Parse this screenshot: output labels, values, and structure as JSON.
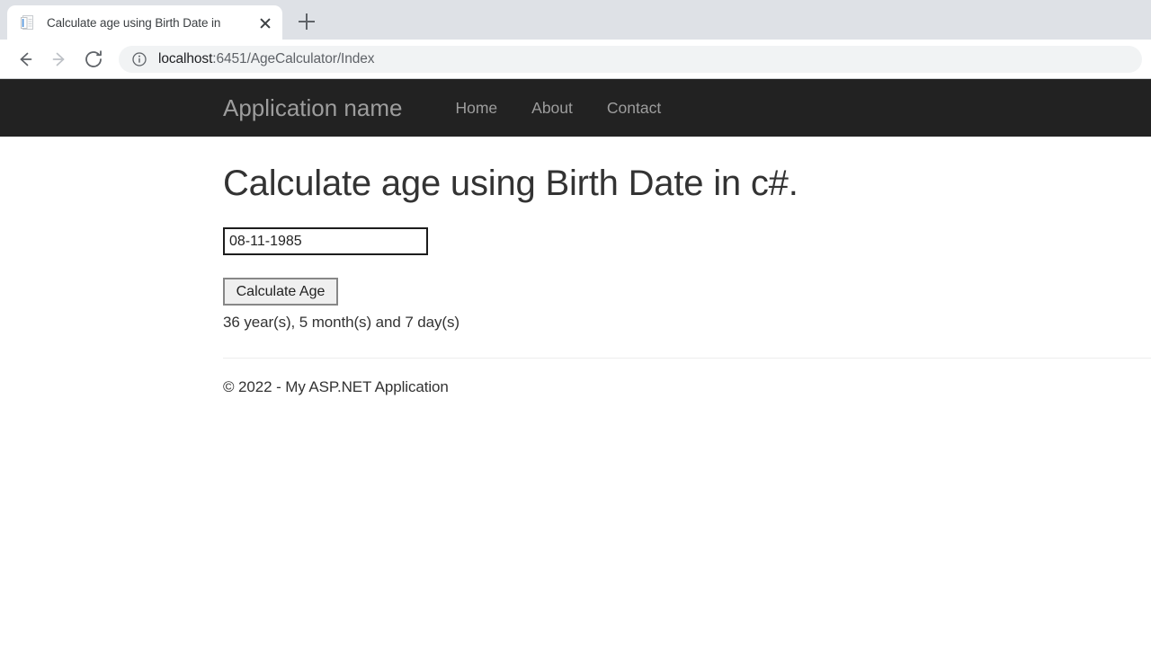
{
  "browser": {
    "tab": {
      "title": "Calculate age using Birth Date in",
      "favicon_name": "document-favicon",
      "close_label": "Close tab"
    },
    "new_tab_label": "New tab",
    "toolbar": {
      "back_label": "Back",
      "forward_label": "Forward",
      "reload_label": "Reload",
      "site_info_label": "View site information",
      "url_host": "localhost",
      "url_path": ":6451/AgeCalculator/Index"
    }
  },
  "page": {
    "navbar": {
      "brand": "Application name",
      "links": [
        {
          "label": "Home"
        },
        {
          "label": "About"
        },
        {
          "label": "Contact"
        }
      ]
    },
    "main": {
      "title": "Calculate age using Birth Date in c#.",
      "birth_date_value": "08-11-1985",
      "birth_date_placeholder": "",
      "calculate_button": "Calculate Age",
      "result": "36 year(s), 5 month(s) and 7 day(s)"
    },
    "footer": {
      "copyright": "© 2022 - My ASP.NET Application"
    }
  },
  "colors": {
    "navbar_bg": "#222222",
    "navbar_text": "#9d9d9d",
    "tabstrip_bg": "#dee1e6",
    "omnibox_bg": "#f1f3f4",
    "page_text": "#333333",
    "button_bg": "#efefef"
  }
}
